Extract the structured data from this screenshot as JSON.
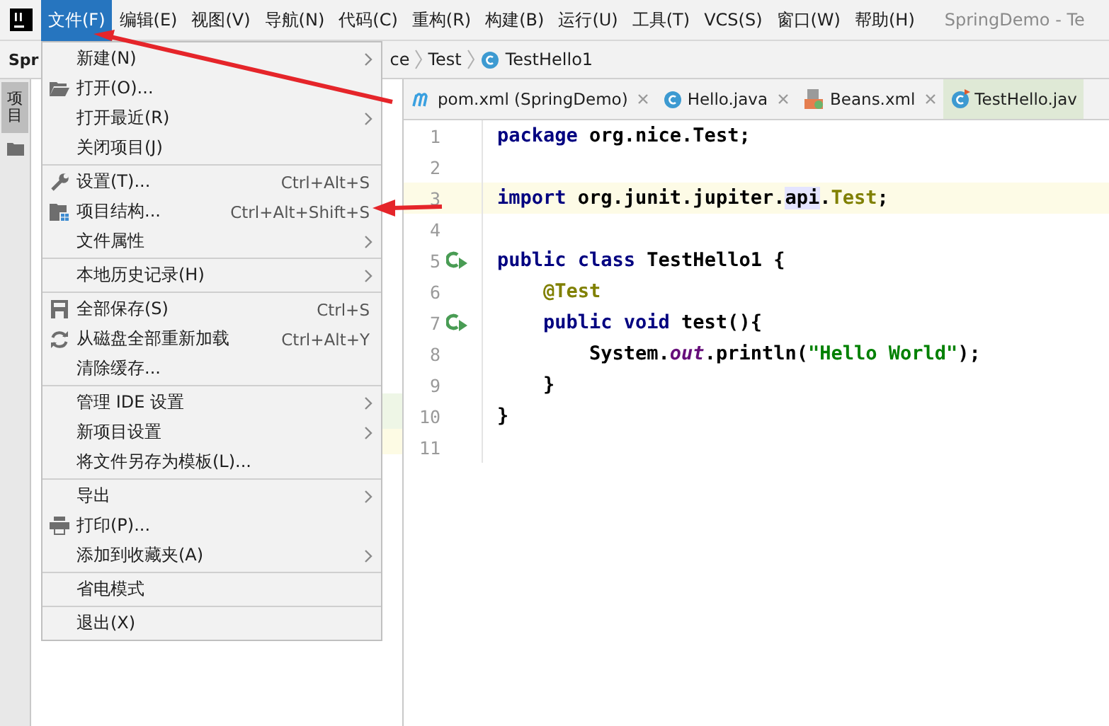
{
  "menubar": {
    "items": [
      {
        "label": "文件(F)",
        "selected": true
      },
      {
        "label": "编辑(E)",
        "selected": false
      },
      {
        "label": "视图(V)",
        "selected": false
      },
      {
        "label": "导航(N)",
        "selected": false
      },
      {
        "label": "代码(C)",
        "selected": false
      },
      {
        "label": "重构(R)",
        "selected": false
      },
      {
        "label": "构建(B)",
        "selected": false
      },
      {
        "label": "运行(U)",
        "selected": false
      },
      {
        "label": "工具(T)",
        "selected": false
      },
      {
        "label": "VCS(S)",
        "selected": false
      },
      {
        "label": "窗口(W)",
        "selected": false
      },
      {
        "label": "帮助(H)",
        "selected": false
      }
    ],
    "title": "SpringDemo - Te"
  },
  "breadcrumb": {
    "project": "Spr",
    "items": [
      {
        "label": "ce",
        "kind": "folder"
      },
      {
        "label": "Test",
        "kind": "folder"
      },
      {
        "label": "TestHello1",
        "kind": "class"
      }
    ]
  },
  "tool_strip": {
    "label": "项目"
  },
  "file_menu": {
    "groups": [
      [
        {
          "label": "新建(N)",
          "submenu": true,
          "kind": "plain"
        },
        {
          "label": "打开(O)...",
          "submenu": false,
          "kind": "folder"
        },
        {
          "label": "打开最近(R)",
          "submenu": true,
          "kind": "plain"
        },
        {
          "label": "关闭项目(J)",
          "submenu": false,
          "kind": "plain"
        }
      ],
      [
        {
          "label": "设置(T)...",
          "shortcut": "Ctrl+Alt+S",
          "submenu": false,
          "kind": "wrench"
        },
        {
          "label": "项目结构...",
          "shortcut": "Ctrl+Alt+Shift+S",
          "submenu": false,
          "kind": "structure"
        },
        {
          "label": "文件属性",
          "submenu": true,
          "kind": "plain"
        }
      ],
      [
        {
          "label": "本地历史记录(H)",
          "submenu": true,
          "kind": "plain"
        }
      ],
      [
        {
          "label": "全部保存(S)",
          "shortcut": "Ctrl+S",
          "submenu": false,
          "kind": "save"
        },
        {
          "label": "从磁盘全部重新加载",
          "shortcut": "Ctrl+Alt+Y",
          "submenu": false,
          "kind": "reload"
        },
        {
          "label": "清除缓存...",
          "submenu": false,
          "kind": "plain"
        }
      ],
      [
        {
          "label": "管理 IDE 设置",
          "submenu": true,
          "kind": "plain"
        },
        {
          "label": "新项目设置",
          "submenu": true,
          "kind": "plain"
        },
        {
          "label": "将文件另存为模板(L)...",
          "submenu": false,
          "kind": "plain"
        }
      ],
      [
        {
          "label": "导出",
          "submenu": true,
          "kind": "plain"
        },
        {
          "label": "打印(P)...",
          "submenu": false,
          "kind": "printer"
        },
        {
          "label": "添加到收藏夹(A)",
          "submenu": true,
          "kind": "plain"
        }
      ],
      [
        {
          "label": "省电模式",
          "submenu": false,
          "kind": "plain"
        }
      ],
      [
        {
          "label": "退出(X)",
          "submenu": false,
          "kind": "plain"
        }
      ]
    ]
  },
  "editor_tabs": [
    {
      "label": "pom.xml (SpringDemo)",
      "kind": "maven",
      "selected": false
    },
    {
      "label": "Hello.java",
      "kind": "class",
      "selected": false
    },
    {
      "label": "Beans.xml",
      "kind": "xml",
      "selected": false
    },
    {
      "label": "TestHello.jav",
      "kind": "test-class",
      "selected": true
    }
  ],
  "code": {
    "lines": [
      {
        "number": "1",
        "current": false,
        "run_marker": false,
        "tokens": [
          {
            "text": "package",
            "kind": "keyword"
          },
          {
            "text": " org.nice.Test;",
            "kind": "plain"
          }
        ]
      },
      {
        "number": "2",
        "current": false,
        "run_marker": false
      },
      {
        "number": "3",
        "current": true,
        "run_marker": false,
        "tokens": [
          {
            "text": "import",
            "kind": "keyword"
          },
          {
            "text": " org.junit.jupiter.",
            "kind": "plain"
          },
          {
            "text": "api",
            "kind": "match"
          },
          {
            "text": ".",
            "kind": "plain"
          },
          {
            "text": "Test",
            "kind": "annotation"
          },
          {
            "text": ";",
            "kind": "plain"
          }
        ]
      },
      {
        "number": "4",
        "current": false,
        "run_marker": false
      },
      {
        "number": "5",
        "current": false,
        "run_marker": true,
        "tokens": [
          {
            "text": "public class",
            "kind": "keyword"
          },
          {
            "text": " TestHello1 {",
            "kind": "plain"
          }
        ]
      },
      {
        "number": "6",
        "current": false,
        "run_marker": false,
        "tokens": [
          {
            "text": "    @Test",
            "kind": "annotation"
          }
        ]
      },
      {
        "number": "7",
        "current": false,
        "run_marker": true,
        "tokens": [
          {
            "text": "    public void",
            "kind": "keyword"
          },
          {
            "text": " test(){",
            "kind": "plain"
          }
        ]
      },
      {
        "number": "8",
        "current": false,
        "run_marker": false,
        "tokens": [
          {
            "text": "        System.",
            "kind": "plain"
          },
          {
            "text": "out",
            "kind": "field"
          },
          {
            "text": ".println(",
            "kind": "plain"
          },
          {
            "text": "\"Hello World\"",
            "kind": "string"
          },
          {
            "text": ");",
            "kind": "plain"
          }
        ]
      },
      {
        "number": "9",
        "current": false,
        "run_marker": false,
        "tokens": [
          {
            "text": "    }",
            "kind": "plain"
          }
        ]
      },
      {
        "number": "10",
        "current": false,
        "run_marker": false,
        "tokens": [
          {
            "text": "}",
            "kind": "plain"
          }
        ]
      },
      {
        "number": "11",
        "current": false,
        "run_marker": false
      }
    ]
  }
}
